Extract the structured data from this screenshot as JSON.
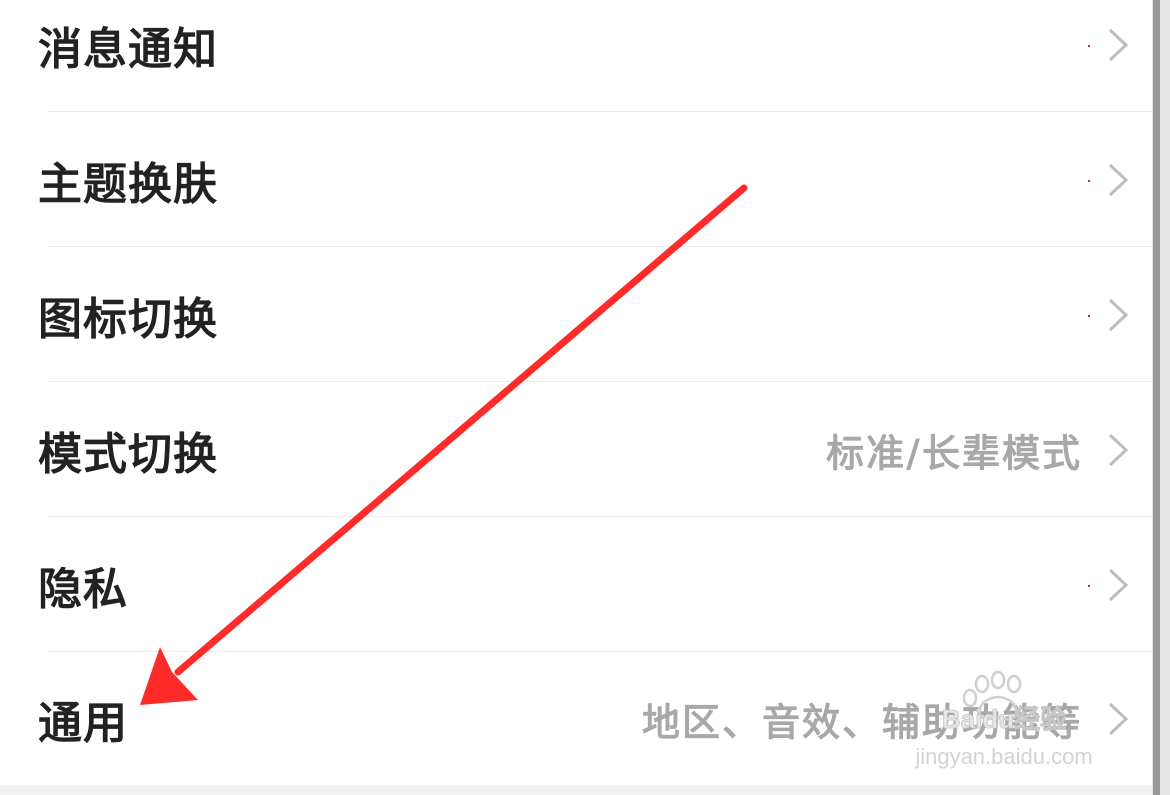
{
  "settings": {
    "items": [
      {
        "label": "消息通知",
        "value": ""
      },
      {
        "label": "主题换肤",
        "value": ""
      },
      {
        "label": "图标切换",
        "value": ""
      },
      {
        "label": "模式切换",
        "value": "标准/长辈模式"
      },
      {
        "label": "隐私",
        "value": ""
      },
      {
        "label": "通用",
        "value": "地区、音效、辅助功能等"
      }
    ],
    "chevron_icon": "chevron-right-icon"
  },
  "annotation": {
    "arrow_color": "#ff2a2a",
    "points_to": "通用"
  },
  "watermark": {
    "brand": "Baidu经验",
    "site": "jingyan.baidu.com"
  }
}
